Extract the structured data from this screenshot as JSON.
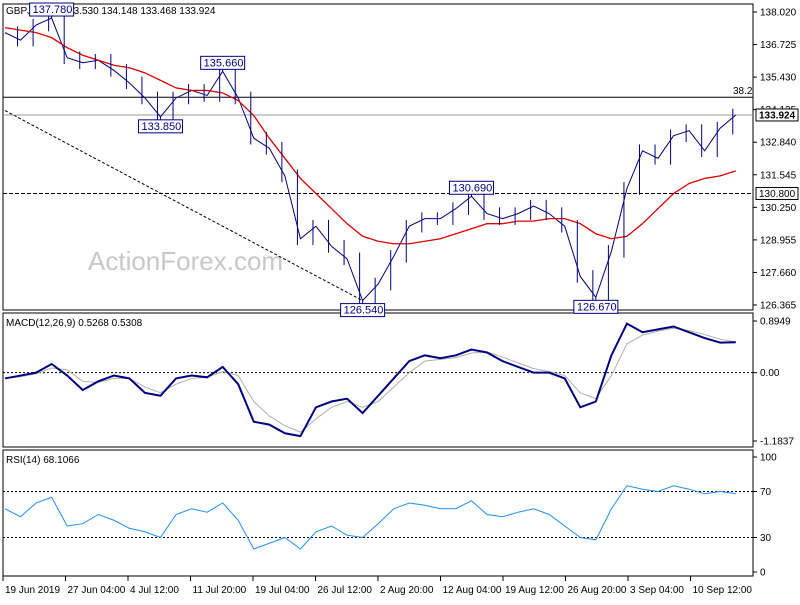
{
  "chart_data": [
    {
      "type": "line",
      "panel": "price",
      "title": "GBPJPY,H4 133.530 134.148 133.468 133.924",
      "symbol": "GBPJPY",
      "timeframe": "H4",
      "ohlc": {
        "open": 133.53,
        "high": 134.148,
        "low": 133.468,
        "close": 133.924
      },
      "ylim": [
        126.365,
        138.02
      ],
      "yticks": [
        138.02,
        136.725,
        135.43,
        134.135,
        132.84,
        131.545,
        130.25,
        128.955,
        127.66,
        126.365
      ],
      "ytick_labels": [
        "138.020",
        "136.725",
        "135.430",
        "134.135",
        "132.840",
        "131.545",
        "130.250",
        "128.955",
        "127.660",
        "126.365"
      ],
      "xtick_labels": [
        "19 Jun 2019",
        "27 Jun 04:00",
        "4 Jul 12:00",
        "11 Jul 20:00",
        "19 Jul 04:00",
        "26 Jul 12:00",
        "2 Aug 20:00",
        "12 Aug 04:00",
        "19 Aug 12:00",
        "26 Aug 20:00",
        "3 Sep 04:00",
        "10 Sep 12:00"
      ],
      "watermark": "ActionForex.com",
      "series": [
        {
          "name": "price",
          "x": [
            0,
            5,
            10,
            15,
            20,
            25,
            30,
            35,
            40,
            45,
            50,
            55,
            60,
            65,
            70,
            75,
            80,
            85,
            90,
            95,
            100,
            105,
            110,
            115,
            120,
            125,
            130,
            135,
            140,
            145,
            150,
            155,
            160,
            165,
            170,
            175,
            180,
            185,
            190,
            195,
            200,
            205,
            210,
            215,
            220,
            225,
            230,
            235
          ],
          "values": [
            137.2,
            136.9,
            137.5,
            137.78,
            136.2,
            136.0,
            136.1,
            135.7,
            135.2,
            134.6,
            133.85,
            134.6,
            134.9,
            134.7,
            135.66,
            134.6,
            133.0,
            132.6,
            131.5,
            129.0,
            129.5,
            128.7,
            128.2,
            126.54,
            127.2,
            128.3,
            129.5,
            129.8,
            129.8,
            130.2,
            130.69,
            130.0,
            129.8,
            130.0,
            130.3,
            130.0,
            129.5,
            127.5,
            126.67,
            128.5,
            131.0,
            132.5,
            132.2,
            133.1,
            133.3,
            132.5,
            133.4,
            133.924
          ]
        },
        {
          "name": "moving-average",
          "x": [
            0,
            5,
            10,
            15,
            20,
            25,
            30,
            35,
            40,
            45,
            50,
            55,
            60,
            65,
            70,
            75,
            80,
            85,
            90,
            95,
            100,
            105,
            110,
            115,
            120,
            125,
            130,
            135,
            140,
            145,
            150,
            155,
            160,
            165,
            170,
            175,
            180,
            185,
            190,
            195,
            200,
            205,
            210,
            215,
            220,
            225,
            230,
            235
          ],
          "values": [
            137.4,
            137.3,
            137.2,
            137.0,
            136.6,
            136.3,
            136.1,
            135.9,
            135.8,
            135.6,
            135.3,
            135.0,
            134.9,
            134.9,
            134.8,
            134.5,
            133.9,
            133.0,
            132.2,
            131.4,
            130.8,
            130.2,
            129.6,
            129.1,
            128.9,
            128.8,
            128.8,
            128.9,
            129.0,
            129.2,
            129.4,
            129.6,
            129.6,
            129.7,
            129.7,
            129.8,
            129.8,
            129.6,
            129.2,
            129.0,
            129.1,
            129.6,
            130.2,
            130.8,
            131.2,
            131.4,
            131.5,
            131.7
          ]
        }
      ],
      "annotations": [
        {
          "label": "137.780",
          "x": 15,
          "value": 137.78
        },
        {
          "label": "133.850",
          "x": 50,
          "value": 133.85
        },
        {
          "label": "135.660",
          "x": 70,
          "value": 135.66
        },
        {
          "label": "126.540",
          "x": 115,
          "value": 126.54
        },
        {
          "label": "130.690",
          "x": 150,
          "value": 130.69
        },
        {
          "label": "126.670",
          "x": 190,
          "value": 126.67
        }
      ],
      "horizontal_lines": [
        {
          "value": 134.63,
          "label": "38.2",
          "style": "solid"
        },
        {
          "value": 130.8,
          "label": "130.800",
          "style": "dashed"
        },
        {
          "value": 133.924,
          "label": "133.924",
          "style": "current-price"
        }
      ],
      "trendline": {
        "x": [
          0,
          115
        ],
        "values": [
          134.1,
          126.54
        ],
        "style": "dashed"
      },
      "colors": {
        "price": "#000080",
        "moving-average": "#dd0000",
        "lines": "#000000",
        "watermark": "#c8c8c8"
      }
    },
    {
      "type": "line",
      "panel": "macd",
      "title": "MACD(12,26,9) 0.5268 0.5308",
      "ylim": [
        -1.1837,
        0.8949
      ],
      "ytick_labels": [
        "0.8949",
        "0.00",
        "-1.1837"
      ],
      "yticks": [
        0.8949,
        0.0,
        -1.1837
      ],
      "series": [
        {
          "name": "macd",
          "x": [
            0,
            5,
            10,
            15,
            20,
            25,
            30,
            35,
            40,
            45,
            50,
            55,
            60,
            65,
            70,
            75,
            80,
            85,
            90,
            95,
            100,
            105,
            110,
            115,
            120,
            125,
            130,
            135,
            140,
            145,
            150,
            155,
            160,
            165,
            170,
            175,
            180,
            185,
            190,
            195,
            200,
            205,
            210,
            215,
            220,
            225,
            230,
            235
          ],
          "values": [
            -0.1,
            -0.05,
            0.0,
            0.15,
            -0.05,
            -0.3,
            -0.15,
            -0.05,
            -0.1,
            -0.35,
            -0.4,
            -0.1,
            -0.05,
            -0.08,
            0.1,
            -0.2,
            -0.85,
            -0.9,
            -1.05,
            -1.1,
            -0.6,
            -0.5,
            -0.45,
            -0.7,
            -0.4,
            -0.1,
            0.2,
            0.3,
            0.25,
            0.3,
            0.4,
            0.35,
            0.2,
            0.1,
            0.0,
            0.0,
            -0.1,
            -0.6,
            -0.5,
            0.3,
            0.85,
            0.7,
            0.75,
            0.8,
            0.7,
            0.6,
            0.52,
            0.5268
          ]
        },
        {
          "name": "signal",
          "x": [
            0,
            5,
            10,
            15,
            20,
            25,
            30,
            35,
            40,
            45,
            50,
            55,
            60,
            65,
            70,
            75,
            80,
            85,
            90,
            95,
            100,
            105,
            110,
            115,
            120,
            125,
            130,
            135,
            140,
            145,
            150,
            155,
            160,
            165,
            170,
            175,
            180,
            185,
            190,
            195,
            200,
            205,
            210,
            215,
            220,
            225,
            230,
            235
          ],
          "values": [
            -0.1,
            -0.07,
            -0.02,
            0.08,
            0.05,
            -0.15,
            -0.17,
            -0.1,
            -0.1,
            -0.25,
            -0.35,
            -0.2,
            -0.1,
            -0.08,
            0.02,
            -0.05,
            -0.5,
            -0.75,
            -0.92,
            -1.03,
            -0.8,
            -0.6,
            -0.5,
            -0.6,
            -0.5,
            -0.25,
            0.0,
            0.2,
            0.23,
            0.26,
            0.34,
            0.36,
            0.27,
            0.17,
            0.07,
            0.02,
            -0.05,
            -0.35,
            -0.45,
            -0.05,
            0.5,
            0.65,
            0.72,
            0.77,
            0.73,
            0.66,
            0.58,
            0.5308
          ]
        }
      ],
      "colors": {
        "macd": "#000080",
        "signal": "#b0b0b0"
      }
    },
    {
      "type": "line",
      "panel": "rsi",
      "title": "RSI(14) 68.1066",
      "ylim": [
        0,
        100
      ],
      "yticks": [
        100,
        70,
        30,
        0
      ],
      "ytick_labels": [
        "100",
        "70",
        "30",
        "0"
      ],
      "series": [
        {
          "name": "rsi",
          "x": [
            0,
            5,
            10,
            15,
            20,
            25,
            30,
            35,
            40,
            45,
            50,
            55,
            60,
            65,
            70,
            75,
            80,
            85,
            90,
            95,
            100,
            105,
            110,
            115,
            120,
            125,
            130,
            135,
            140,
            145,
            150,
            155,
            160,
            165,
            170,
            175,
            180,
            185,
            190,
            195,
            200,
            205,
            210,
            215,
            220,
            225,
            230,
            235
          ],
          "values": [
            55,
            48,
            60,
            65,
            40,
            42,
            50,
            45,
            38,
            35,
            30,
            50,
            55,
            52,
            60,
            45,
            20,
            25,
            30,
            20,
            35,
            40,
            32,
            30,
            42,
            55,
            60,
            58,
            55,
            55,
            62,
            50,
            48,
            52,
            55,
            50,
            40,
            30,
            28,
            55,
            75,
            72,
            70,
            75,
            72,
            68,
            70,
            68.1066
          ]
        }
      ],
      "colors": {
        "rsi": "#1e90ff",
        "levels": "#000000"
      }
    }
  ]
}
